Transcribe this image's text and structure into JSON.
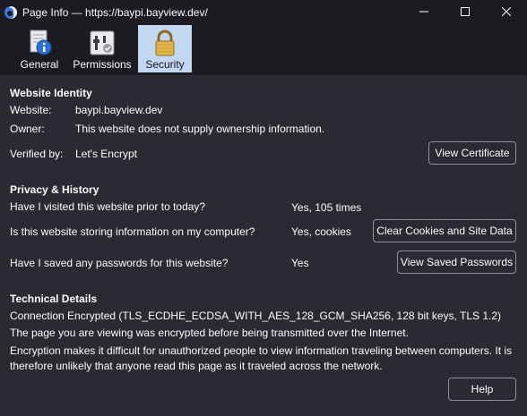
{
  "window": {
    "title": "Page Info — https://baypi.bayview.dev/"
  },
  "toolbar": {
    "tabs": [
      {
        "label": "General",
        "icon": "info-page-icon",
        "active": false
      },
      {
        "label": "Permissions",
        "icon": "permissions-switches-icon",
        "active": false
      },
      {
        "label": "Security",
        "icon": "padlock-icon",
        "active": true
      }
    ]
  },
  "identity": {
    "heading": "Website Identity",
    "website_label": "Website:",
    "website_value": "baypi.bayview.dev",
    "owner_label": "Owner:",
    "owner_value": "This website does not supply ownership information.",
    "verified_label": "Verified by:",
    "verified_value": "Let's Encrypt",
    "view_certificate_button": "View Certificate"
  },
  "privacy": {
    "heading": "Privacy & History",
    "visited_question": "Have I visited this website prior to today?",
    "visited_answer": "Yes, 105 times",
    "storing_question": "Is this website storing information on my computer?",
    "storing_answer": "Yes, cookies",
    "clear_cookies_button": "Clear Cookies and Site Data",
    "passwords_question": "Have I saved any passwords for this website?",
    "passwords_answer": "Yes",
    "view_passwords_button": "View Saved Passwords"
  },
  "technical": {
    "heading": "Technical Details",
    "connection": "Connection Encrypted (TLS_ECDHE_ECDSA_WITH_AES_128_GCM_SHA256, 128 bit keys, TLS 1.2)",
    "encrypted_note": "The page you are viewing was encrypted before being transmitted over the Internet.",
    "explanation": "Encryption makes it difficult for unauthorized people to view information traveling between computers. It is therefore unlikely that anyone read this page as it traveled across the network."
  },
  "footer": {
    "help_button": "Help"
  },
  "colors": {
    "window_bg": "#1c1b22",
    "content_bg": "#2b2a33",
    "text": "#fbfbfe",
    "active_tab_bg": "#c2d7f2",
    "button_border": "#8f8f9d"
  }
}
